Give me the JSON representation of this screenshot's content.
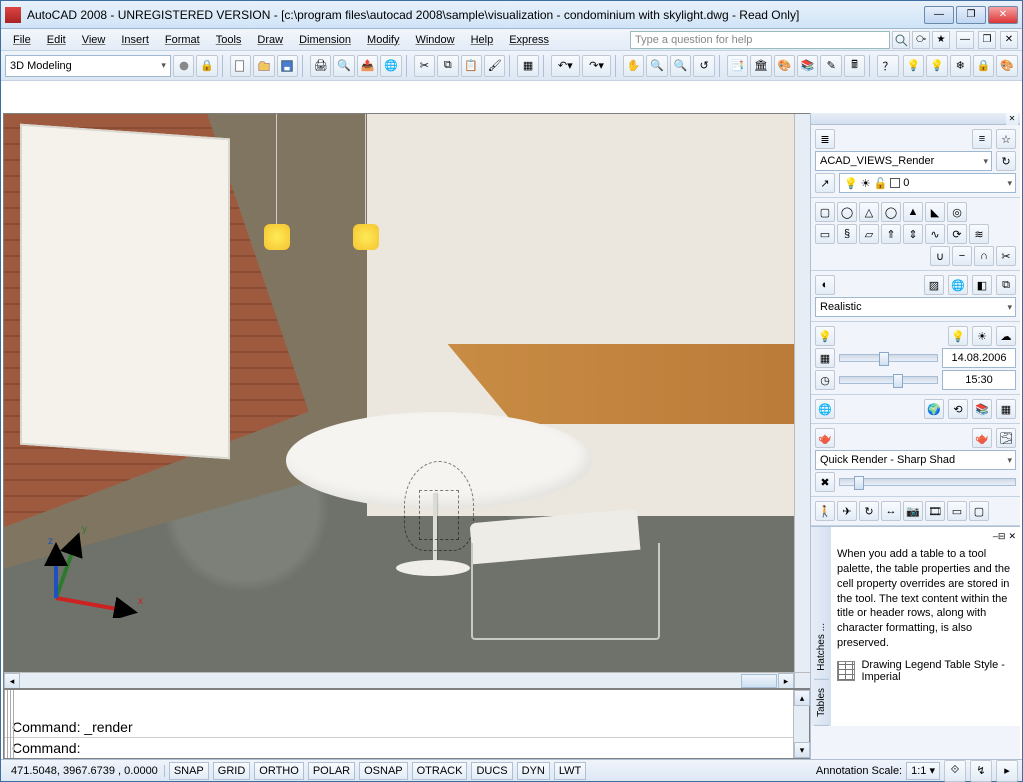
{
  "app": {
    "title": "AutoCAD 2008 - UNREGISTERED VERSION - [c:\\program files\\autocad 2008\\sample\\visualization - condominium with skylight.dwg - Read Only]"
  },
  "menu": [
    "File",
    "Edit",
    "View",
    "Insert",
    "Format",
    "Tools",
    "Draw",
    "Dimension",
    "Modify",
    "Window",
    "Help",
    "Express"
  ],
  "help_search_placeholder": "Type a question for help",
  "workspace_combo": "3D Modeling",
  "cmd": {
    "history_line": "Command: _render",
    "prompt": "Command:"
  },
  "panels": {
    "layer_filter": "ACAD_VIEWS_Render",
    "layer_current": "0",
    "visual_style": "Realistic",
    "sun_date": "14.08.2006",
    "sun_time": "15:30",
    "render_preset": "Quick Render - Sharp Shad"
  },
  "tool_palette": {
    "tabs": [
      "Hatches ...",
      "Tables"
    ],
    "desc": "When you add a table to a tool palette, the table properties and the cell property overrides are stored in the tool. The text content within the title or header rows, along with character formatting, is also preserved.",
    "item_label": "Drawing Legend Table Style - Imperial"
  },
  "status": {
    "coords": "471.5048,  3967.6739 , 0.0000",
    "toggles": [
      "SNAP",
      "GRID",
      "ORTHO",
      "POLAR",
      "OSNAP",
      "OTRACK",
      "DUCS",
      "DYN",
      "LWT"
    ],
    "annotation_label": "Annotation Scale:",
    "annotation_value": "1:1"
  }
}
